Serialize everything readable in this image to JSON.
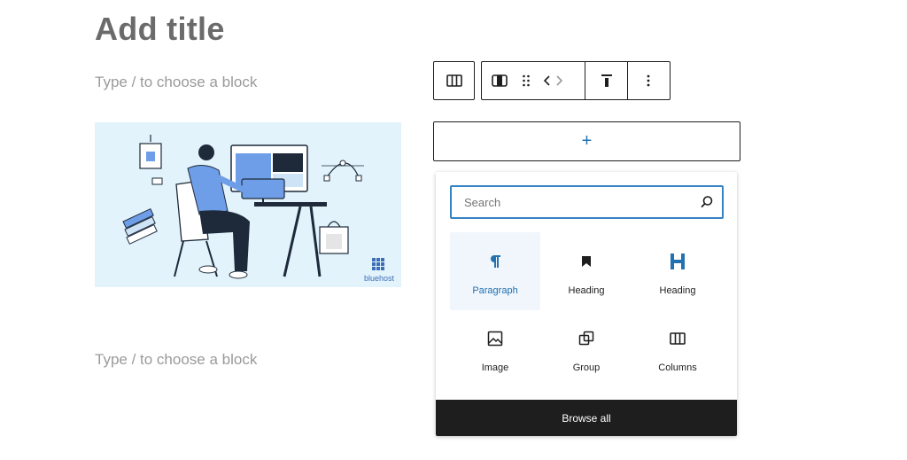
{
  "post": {
    "title_placeholder": "Add title",
    "block_placeholder_1": "Type / to choose a block",
    "block_placeholder_2": "Type / to choose a block"
  },
  "image": {
    "brand_text": "bluehost"
  },
  "toolbar": {
    "icons": [
      "columns-icon",
      "column-icon",
      "drag-handle-icon",
      "move-left-icon",
      "move-right-icon",
      "vertical-align-top-icon",
      "more-options-icon"
    ]
  },
  "add_block": {
    "label": "+"
  },
  "inserter": {
    "search_placeholder": "Search",
    "blocks": [
      {
        "label": "Paragraph",
        "icon": "paragraph-icon",
        "selected": true
      },
      {
        "label": "Heading",
        "icon": "bookmark-icon"
      },
      {
        "label": "Heading",
        "icon": "heading-icon"
      },
      {
        "label": "Image",
        "icon": "image-icon"
      },
      {
        "label": "Group",
        "icon": "group-icon"
      },
      {
        "label": "Columns",
        "icon": "columns-icon"
      }
    ],
    "browse_all": "Browse all"
  },
  "colors": {
    "accent": "#2271b1",
    "focus": "#3582c4",
    "dark": "#1e1e1e",
    "image_bg": "#e3f3fc"
  }
}
